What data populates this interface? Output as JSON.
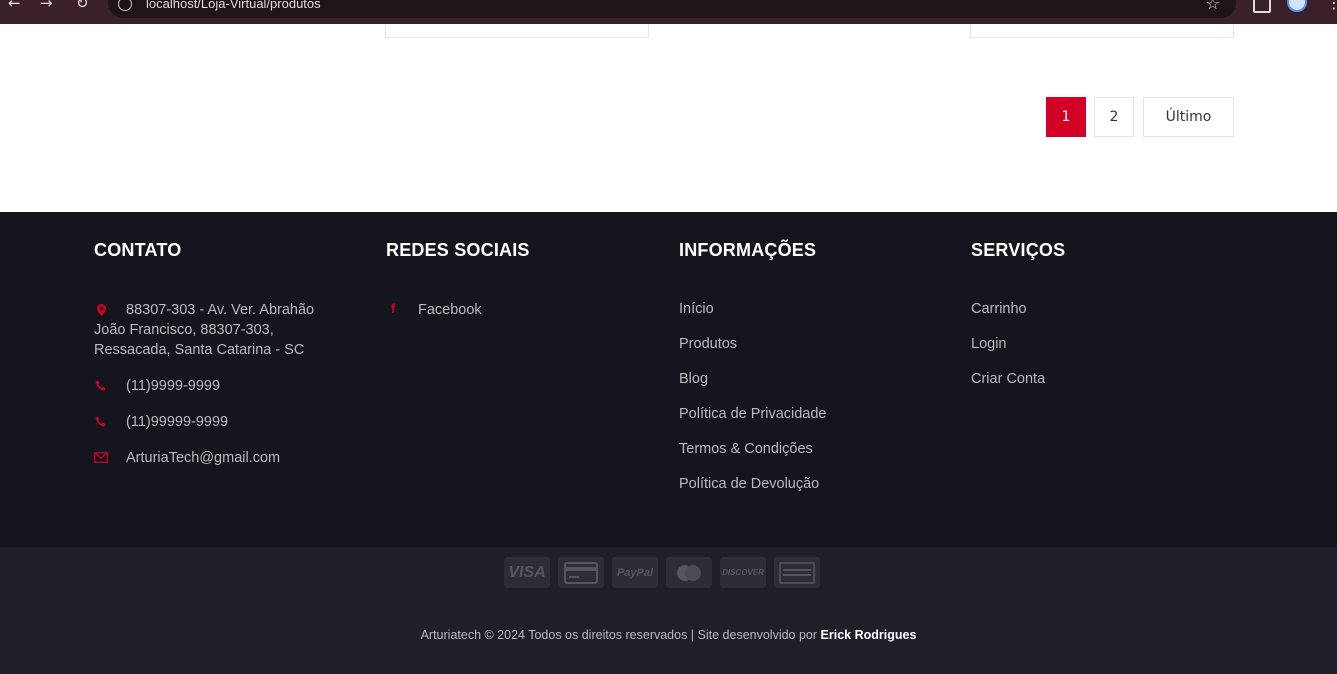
{
  "browser": {
    "url": "localhost/Loja-Virtual/produtos",
    "back_glyph": "←",
    "forward_glyph": "→",
    "reload_glyph": "↻",
    "star_glyph": "☆",
    "menu_glyph": "⋮"
  },
  "pagination": {
    "pages": [
      "1",
      "2"
    ],
    "last_label": "Último",
    "current_page": "1",
    "active_color": "#d10024"
  },
  "footer": {
    "contato": {
      "title": "CONTATO",
      "address": "88307-303 - Av. Ver. Abrahão João Francisco, 88307-303, Ressacada, Santa Catarina - SC",
      "phone1": "(11)9999-9999",
      "phone2": "(11)99999-9999",
      "email": "ArturiaTech@gmail.com"
    },
    "redes": {
      "title": "REDES SOCIAIS",
      "facebook": "Facebook",
      "facebook_glyph": "f"
    },
    "informacoes": {
      "title": "INFORMAÇÕES",
      "links": [
        "Início",
        "Produtos",
        "Blog",
        "Política de Privacidade",
        "Termos & Condições",
        "Política de Devolução"
      ]
    },
    "servicos": {
      "title": "SERVIÇOS",
      "links": [
        "Carrinho",
        "Login",
        "Criar Conta"
      ]
    },
    "payments": [
      "VISA",
      "",
      "PayPal",
      "",
      "DISCOVER",
      ""
    ],
    "copyright_text": "Arturiatech © 2024 Todos os direitos reservados | Site desenvolvido por",
    "author": "Erick Rodrigues"
  },
  "colors": {
    "accent": "#d10024",
    "footer_top": "#15161d",
    "footer_bottom": "#1e1f29"
  }
}
